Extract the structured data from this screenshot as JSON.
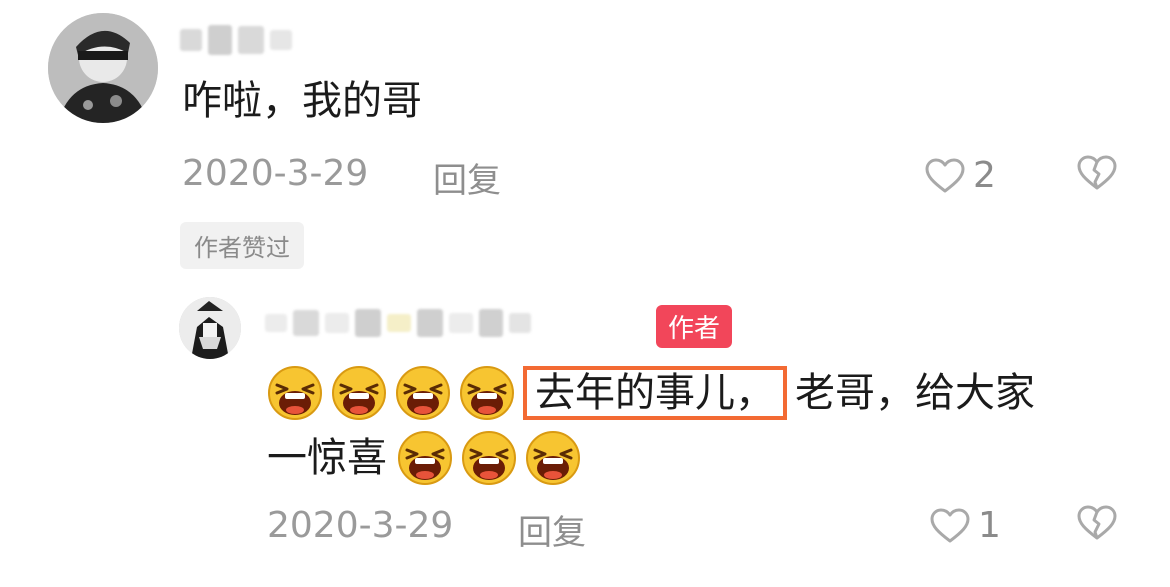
{
  "comment1": {
    "text": "咋啦，我的哥",
    "date": "2020-3-29",
    "reply_label": "回复",
    "likes": "2",
    "badge": "作者赞过"
  },
  "comment2": {
    "author_tag": "作者",
    "text_highlight": "去年的事儿，",
    "text_rest": "老哥，给大家",
    "text_line2": "一惊喜",
    "date": "2020-3-29",
    "reply_label": "回复",
    "likes": "1"
  },
  "icons": {
    "like": "heart-outline-icon",
    "dislike": "broken-heart-icon",
    "emoji": "laughing-emoji"
  },
  "colors": {
    "highlight_border": "#f36a33",
    "author_tag_bg": "#f2465a",
    "badge_bg": "#f1f1f1"
  }
}
